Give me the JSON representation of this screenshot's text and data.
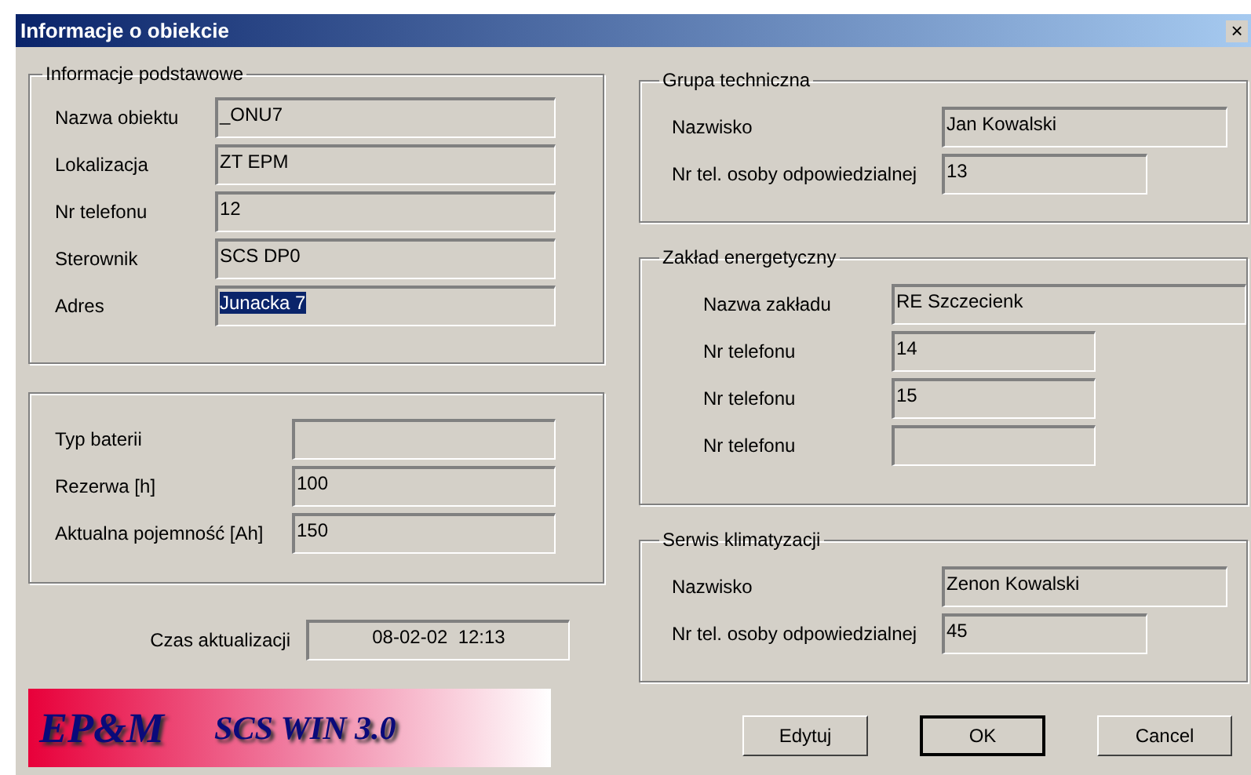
{
  "window": {
    "title": "Informacje o obiekcie",
    "close": "×"
  },
  "basic_info": {
    "title": "Informacje podstawowe",
    "fields": [
      {
        "label": "Nazwa obiektu",
        "value": "_ONU7",
        "selected": false
      },
      {
        "label": "Lokalizacja",
        "value": "ZT EPM",
        "selected": false
      },
      {
        "label": "Nr telefonu",
        "value": "12",
        "selected": false
      },
      {
        "label": "Sterownik",
        "value": "SCS DP0",
        "selected": false
      },
      {
        "label": "Adres",
        "value": "Junacka 7",
        "selected": true
      }
    ]
  },
  "battery": {
    "fields": [
      {
        "label": "Typ baterii"
      },
      {
        "label": "Rezerwa [h]",
        "value": "100"
      },
      {
        "label": "Aktualna pojemność [Ah]",
        "value": "150"
      }
    ]
  },
  "update_time": {
    "label": "Czas aktualizacji",
    "value": "08-02-02  12:13"
  },
  "logo": {
    "brand": "EP&M",
    "product": "SCS WIN 3.0"
  },
  "technical_group": {
    "title": "Grupa techniczna",
    "fields": [
      {
        "label": "Nazwisko",
        "value": "Jan Kowalski"
      },
      {
        "label": "Nr tel. osoby odpowiedzialnej",
        "value": "13"
      }
    ]
  },
  "power_company": {
    "title": "Zakład energetyczny",
    "fields": [
      {
        "label": "Nazwa zakładu",
        "value": "RE Szczecienk"
      },
      {
        "label": "Nr telefonu",
        "value": "14"
      },
      {
        "label": "Nr telefonu",
        "value": "15"
      },
      {
        "label": "Nr telefonu"
      }
    ]
  },
  "ac_service": {
    "title": "Serwis klimatyzacji",
    "fields": [
      {
        "label": "Nazwisko",
        "value": "Zenon Kowalski"
      },
      {
        "label": "Nr tel. osoby odpowiedzialnej",
        "value": "45"
      }
    ]
  },
  "buttons": [
    {
      "label": "Edytuj",
      "default": false
    },
    {
      "label": "OK",
      "default": true
    },
    {
      "label": "Cancel",
      "default": false
    }
  ]
}
